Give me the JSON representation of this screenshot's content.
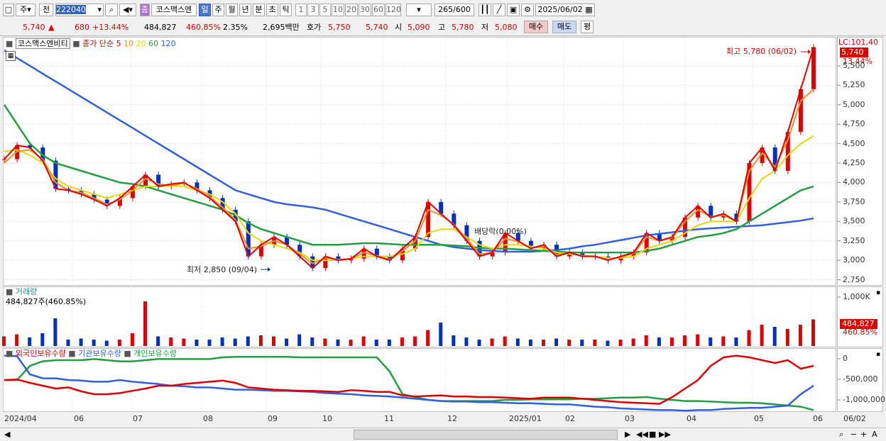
{
  "toolbar": {
    "market_mode": "주",
    "prev_label": "전",
    "code": "222040",
    "badge": "종",
    "name": "코스맥스엔",
    "periods": [
      "일",
      "주",
      "월",
      "년",
      "분",
      "초",
      "틱"
    ],
    "active_period": "일",
    "intervals": [
      "1",
      "3",
      "5",
      "10",
      "20",
      "30",
      "60",
      "120"
    ],
    "count": "265",
    "count_max": "/600",
    "date": "2025/06/02"
  },
  "quote": {
    "price": "5,740",
    "change": "680",
    "change_pct": "+13.44%",
    "volume": "484,827",
    "volume_pct": "460.85%",
    "turnover": "2.35%",
    "amount": "2,695백만",
    "bid_label": "호가",
    "bid1": "5,750",
    "bid2": "5,740",
    "open_label": "시",
    "open": "5,090",
    "high_label": "고",
    "high": "5,780",
    "low_label": "저",
    "low": "5,080",
    "buy_button": "매수",
    "sell_button": "매도",
    "eval_button": "평"
  },
  "price_pane": {
    "title": "코스맥스엔비티",
    "ma_label": "종가 단순",
    "ma_periods": [
      "5",
      "10",
      "20",
      "60",
      "120"
    ],
    "ma_colors": [
      "#e00000",
      "#f09020",
      "#e8d800",
      "#20a040",
      "#3060e0"
    ],
    "lc_label": "LC:101,40",
    "max_label": "최고 5,780 (06/02)",
    "min_label": "최저 2,850 (09/04)",
    "ex_label": "배당락(0.00%)",
    "current_tag": "5,740",
    "current_pct": "13.44%"
  },
  "volume_pane": {
    "title": "거래량",
    "value_label": "484,827주(460.85%)",
    "tag": "484,827",
    "tag_pct": "460.85%"
  },
  "holdings_pane": {
    "foreign": "외국인보유수량",
    "institution": "기관보유수량",
    "individual": "개인보유수량",
    "colors": [
      "#e00000",
      "#3060e0",
      "#20a040"
    ]
  },
  "chart_data": {
    "type": "line",
    "price_axis_ticks": [
      "5,500",
      "5,250",
      "5,000",
      "4,750",
      "4,500",
      "4,250",
      "4,000",
      "3,750",
      "3,500",
      "3,250",
      "3,000",
      "2,750"
    ],
    "volume_axis_ticks": [
      "1,000K"
    ],
    "holdings_axis_ticks": [
      "0",
      "-500,000",
      "-1,000,000"
    ],
    "x_labels": [
      "2024/04",
      "06",
      "07",
      "08",
      "09",
      "10",
      "11",
      "12",
      "2025/01",
      "02",
      "03",
      "04",
      "05",
      "06",
      "06/02"
    ],
    "close_series": {
      "name": "",
      "values": [
        4300,
        4480,
        4450,
        4280,
        3920,
        3900,
        3850,
        3780,
        3700,
        3800,
        3950,
        4100,
        3950,
        3980,
        4000,
        3900,
        3800,
        3650,
        3500,
        3050,
        3200,
        3300,
        3200,
        3050,
        2900,
        3050,
        3000,
        3020,
        3150,
        3050,
        3000,
        3150,
        3300,
        3750,
        3600,
        3450,
        3250,
        3050,
        3100,
        3350,
        3250,
        3150,
        3200,
        3050,
        3100,
        3050,
        3050,
        3000,
        3050,
        3100,
        3350,
        3250,
        3300,
        3550,
        3700,
        3550,
        3600,
        3500,
        4250,
        4450,
        4150,
        4650,
        5200,
        5740
      ]
    },
    "ma5_series": {
      "name": "5",
      "values": [
        4250,
        4400,
        4420,
        4300,
        4000,
        3900,
        3870,
        3800,
        3720,
        3780,
        3900,
        4050,
        3980,
        3960,
        3990,
        3920,
        3820,
        3680,
        3520,
        3150,
        3180,
        3250,
        3200,
        3080,
        2960,
        3030,
        3010,
        3020,
        3100,
        3060,
        3010,
        3120,
        3250,
        3650,
        3580,
        3460,
        3280,
        3080,
        3100,
        3280,
        3240,
        3160,
        3180,
        3070,
        3090,
        3060,
        3050,
        3010,
        3040,
        3090,
        3300,
        3250,
        3290,
        3500,
        3650,
        3560,
        3580,
        3500,
        4150,
        4380,
        4200,
        4550,
        5050,
        5200
      ]
    },
    "ma20_series": {
      "name": "20",
      "values": [
        4400,
        4420,
        4350,
        4250,
        4050,
        3950,
        3900,
        3850,
        3800,
        3850,
        3900,
        3950,
        3950,
        3960,
        3950,
        3900,
        3850,
        3750,
        3600,
        3350,
        3250,
        3200,
        3150,
        3100,
        3000,
        3000,
        3000,
        3020,
        3050,
        3050,
        3050,
        3080,
        3150,
        3350,
        3400,
        3400,
        3300,
        3200,
        3150,
        3200,
        3200,
        3180,
        3150,
        3100,
        3080,
        3060,
        3050,
        3030,
        3030,
        3050,
        3150,
        3200,
        3250,
        3350,
        3450,
        3500,
        3500,
        3500,
        3800,
        4050,
        4150,
        4350,
        4500,
        4600
      ]
    },
    "ma60_series": {
      "name": "60",
      "values": [
        5000,
        4750,
        4500,
        4350,
        4250,
        4200,
        4150,
        4100,
        4050,
        4000,
        3980,
        3950,
        3900,
        3850,
        3800,
        3750,
        3700,
        3650,
        3580,
        3480,
        3400,
        3350,
        3300,
        3250,
        3200,
        3200,
        3200,
        3210,
        3220,
        3220,
        3210,
        3200,
        3200,
        3200,
        3200,
        3190,
        3180,
        3160,
        3150,
        3150,
        3140,
        3130,
        3120,
        3110,
        3100,
        3100,
        3100,
        3100,
        3100,
        3100,
        3120,
        3150,
        3200,
        3250,
        3300,
        3320,
        3350,
        3400,
        3500,
        3600,
        3700,
        3800,
        3900,
        3950
      ]
    },
    "ma120_series": {
      "name": "120",
      "values": [
        5700,
        5600,
        5500,
        5400,
        5300,
        5200,
        5100,
        5000,
        4900,
        4800,
        4700,
        4600,
        4500,
        4400,
        4300,
        4200,
        4100,
        4000,
        3900,
        3850,
        3800,
        3750,
        3720,
        3700,
        3680,
        3650,
        3600,
        3550,
        3500,
        3450,
        3400,
        3350,
        3300,
        3250,
        3200,
        3170,
        3150,
        3130,
        3120,
        3110,
        3110,
        3110,
        3120,
        3130,
        3150,
        3180,
        3200,
        3230,
        3260,
        3290,
        3320,
        3340,
        3360,
        3380,
        3400,
        3410,
        3420,
        3430,
        3440,
        3450,
        3470,
        3490,
        3510,
        3540
      ]
    },
    "volume_values": [
      90,
      110,
      80,
      120,
      260,
      60,
      70,
      60,
      50,
      60,
      120,
      420,
      90,
      80,
      70,
      60,
      60,
      80,
      70,
      90,
      100,
      90,
      70,
      110,
      80,
      70,
      60,
      60,
      90,
      60,
      60,
      80,
      90,
      150,
      220,
      100,
      80,
      60,
      70,
      90,
      70,
      60,
      60,
      70,
      60,
      60,
      60,
      50,
      60,
      70,
      100,
      80,
      80,
      100,
      110,
      80,
      90,
      80,
      150,
      200,
      180,
      160,
      200,
      250
    ],
    "holdings": {
      "foreign": [
        0.45,
        0.44,
        0.5,
        0.55,
        0.6,
        0.58,
        0.65,
        0.7,
        0.7,
        0.68,
        0.64,
        0.6,
        0.55,
        0.55,
        0.52,
        0.5,
        0.48,
        0.46,
        0.5,
        0.58,
        0.6,
        0.62,
        0.63,
        0.64,
        0.64,
        0.65,
        0.66,
        0.63,
        0.64,
        0.66,
        0.66,
        0.72,
        0.74,
        0.73,
        0.72,
        0.74,
        0.74,
        0.75,
        0.75,
        0.76,
        0.77,
        0.78,
        0.76,
        0.76,
        0.76,
        0.78,
        0.8,
        0.82,
        0.84,
        0.85,
        0.86,
        0.87,
        0.75,
        0.6,
        0.45,
        0.2,
        0.05,
        0.02,
        0.05,
        0.1,
        0.15,
        0.1,
        0.25,
        0.2
      ],
      "institution": [
        0.02,
        0.03,
        0.35,
        0.42,
        0.42,
        0.45,
        0.46,
        0.48,
        0.48,
        0.45,
        0.48,
        0.5,
        0.52,
        0.55,
        0.56,
        0.58,
        0.58,
        0.6,
        0.62,
        0.62,
        0.63,
        0.64,
        0.64,
        0.65,
        0.66,
        0.68,
        0.69,
        0.7,
        0.72,
        0.73,
        0.74,
        0.76,
        0.78,
        0.8,
        0.82,
        0.83,
        0.83,
        0.84,
        0.84,
        0.85,
        0.86,
        0.86,
        0.87,
        0.88,
        0.88,
        0.9,
        0.92,
        0.93,
        0.95,
        0.96,
        0.97,
        0.98,
        0.98,
        0.99,
        0.98,
        0.98,
        0.96,
        0.95,
        0.94,
        0.94,
        0.92,
        0.9,
        0.7,
        0.55
      ],
      "individual": [
        0.45,
        0.45,
        0.2,
        0.12,
        0.1,
        0.1,
        0.1,
        0.08,
        0.1,
        0.12,
        0.12,
        0.1,
        0.08,
        0.08,
        0.08,
        0.08,
        0.08,
        0.05,
        0.04,
        0.04,
        0.04,
        0.04,
        0.04,
        0.05,
        0.05,
        0.05,
        0.05,
        0.05,
        0.05,
        0.05,
        0.3,
        0.7,
        0.75,
        0.8,
        0.82,
        0.82,
        0.82,
        0.82,
        0.82,
        0.8,
        0.8,
        0.79,
        0.79,
        0.79,
        0.79,
        0.78,
        0.78,
        0.77,
        0.76,
        0.76,
        0.75,
        0.78,
        0.8,
        0.82,
        0.82,
        0.83,
        0.84,
        0.85,
        0.85,
        0.86,
        0.88,
        0.9,
        0.92,
        0.98
      ]
    },
    "ylim": [
      2700,
      5800
    ],
    "grid": true
  }
}
